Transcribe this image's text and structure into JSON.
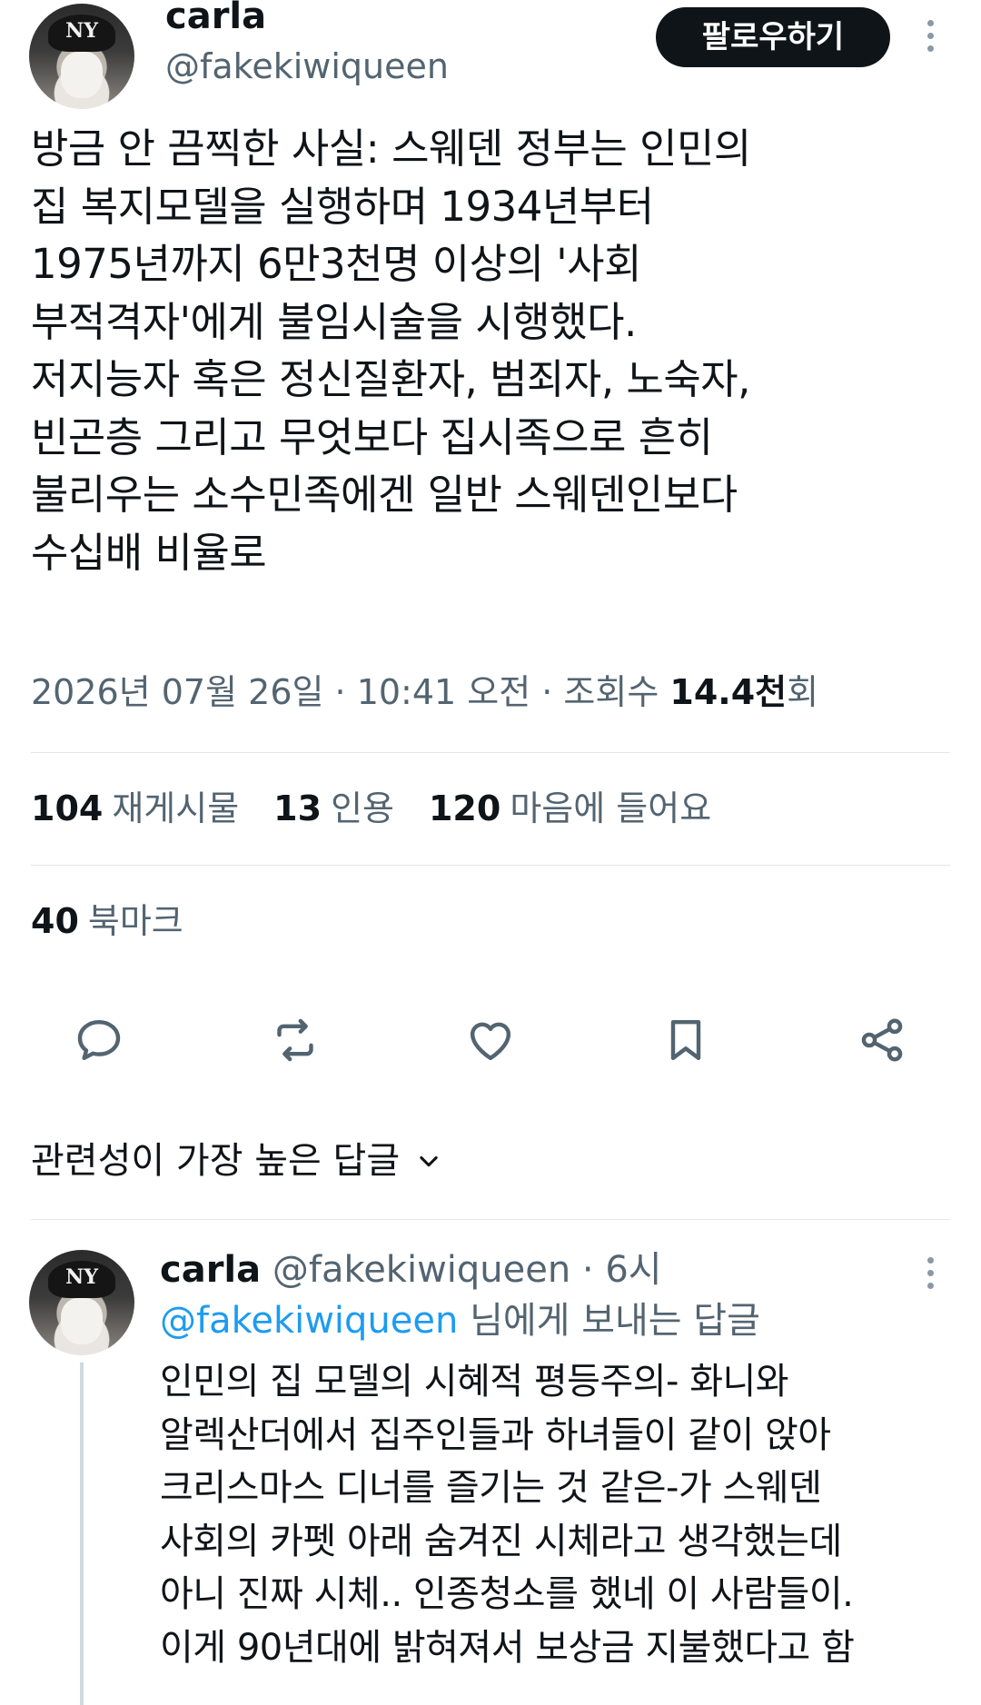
{
  "author": {
    "display_name": "carla",
    "handle": "@fakekiwiqueen",
    "avatar_logo": "NY",
    "follow_label": "팔로우하기"
  },
  "tweet": {
    "text": "방금 안 끔찍한 사실: 스웨덴 정부는 인민의\n집 복지모델을 실행하며 1934년부터\n1975년까지 6만3천명 이상의 '사회\n부적격자'에게 불임시술을 시행했다.\n저지능자 혹은 정신질환자, 범죄자, 노숙자,\n빈곤층 그리고 무엇보다 집시족으로 흔히\n불리우는 소수민족에겐 일반 스웨덴인보다\n수십배 비율로",
    "meta_prefix": "2026년 07월 26일 · 10:41 오전 · 조회수 ",
    "views": "14.4천",
    "views_suffix": "회"
  },
  "stats": {
    "retweets_count": "104",
    "retweets_label": "재게시물",
    "quotes_count": "13",
    "quotes_label": "인용",
    "likes_count": "120",
    "likes_label": "마음에 들어요",
    "bookmarks_count": "40",
    "bookmarks_label": "북마크"
  },
  "actions": [
    "reply-icon",
    "retweet-icon",
    "like-icon",
    "bookmark-icon",
    "share-icon"
  ],
  "replies_sort": {
    "label": "관련성이 가장 높은 답글"
  },
  "reply": {
    "display_name": "carla",
    "handle_time": " @fakekiwiqueen · 6시",
    "mention": "@fakekiwiqueen",
    "reply_to_suffix": " 님에게 보내는 답글",
    "text": "인민의 집 모델의 시혜적 평등주의- 화니와\n알렉산더에서 집주인들과 하녀들이 같이 앉아\n크리스마스 디너를 즐기는 것 같은-가 스웨덴\n사회의 카펫 아래 숨겨진 시체라고 생각했는데\n아니 진짜 시체.. 인종청소를 했네 이 사람들이.\n이게 90년대에 밝혀져서 보상금 지불했다고 함"
  },
  "colors": {
    "text_primary": "#0f1419",
    "text_secondary": "#536471",
    "accent_link": "#1d9bf0",
    "follow_button_bg": "#0f1419",
    "divider": "#e3e6e9"
  }
}
